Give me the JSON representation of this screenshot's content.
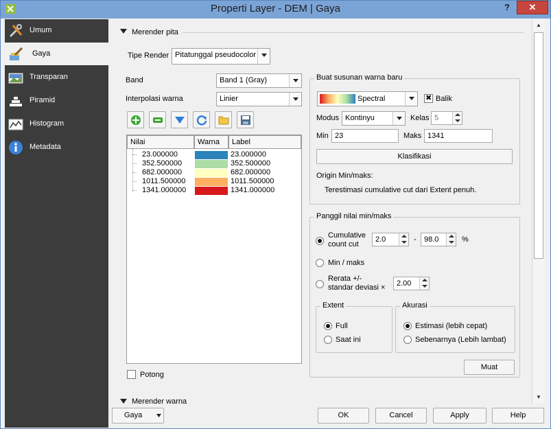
{
  "window": {
    "title": "Properti Layer - DEM | Gaya",
    "help": "?",
    "close": "✕"
  },
  "sidebar": [
    {
      "label": "Umum",
      "icon": "tools-icon"
    },
    {
      "label": "Gaya",
      "icon": "paintbrush-icon"
    },
    {
      "label": "Transparan",
      "icon": "transparency-icon"
    },
    {
      "label": "Piramid",
      "icon": "pyramid-icon"
    },
    {
      "label": "Histogram",
      "icon": "histogram-icon"
    },
    {
      "label": "Metadata",
      "icon": "info-icon"
    }
  ],
  "band_render": {
    "section": "Merender pita",
    "tipe_render_label": "Tipe Render",
    "tipe_render_value": "Pitatunggal pseudocolor",
    "band_label": "Band",
    "band_value": "Band 1 (Gray)",
    "interp_label": "Interpolasi warna",
    "interp_value": "Linier",
    "table_headers": {
      "value": "Nilai",
      "color": "Warna",
      "label": "Label"
    },
    "rows": [
      {
        "value": "23.000000",
        "color": "#2b83ba",
        "label": "23.000000"
      },
      {
        "value": "352.500000",
        "color": "#abdda4",
        "label": "352.500000"
      },
      {
        "value": "682.000000",
        "color": "#ffffbf",
        "label": "682.000000"
      },
      {
        "value": "1011.500000",
        "color": "#fdae61",
        "label": "1011.500000"
      },
      {
        "value": "1341.000000",
        "color": "#d7191c",
        "label": "1341.000000"
      }
    ],
    "potong_label": "Potong"
  },
  "new_color": {
    "title": "Buat susunan warna baru",
    "ramp": "Spectral",
    "balik_label": "Balik",
    "modus_label": "Modus",
    "modus_value": "Kontinyu",
    "kelas_label": "Kelas",
    "kelas_value": "5",
    "min_label": "Min",
    "min_value": "23",
    "maks_label": "Maks",
    "maks_value": "1341",
    "klasifikasi": "Klasifikasi",
    "origin": "Origin Min/maks:",
    "origin_desc": "Terestimasi cumulative cut dari Extent penuh."
  },
  "load_minmax": {
    "title": "Panggil nilai min/maks",
    "cumulative_label_1": "Cumulative",
    "cumulative_label_2": "count cut",
    "cut_min": "2.0",
    "dash": "-",
    "cut_max": "98.0",
    "percent": "%",
    "minmax_label": "Min / maks",
    "rerata_label_1": "Rerata +/-",
    "rerata_label_2": "standar deviasi ×",
    "std_value": "2.00",
    "extent_title": "Extent",
    "extent_full": "Full",
    "extent_current": "Saat ini",
    "akurasi_title": "Akurasi",
    "akurasi_est": "Estimasi (lebih cepat)",
    "akurasi_actual": "Sebenarnya (Lebih lambat)",
    "muat": "Muat"
  },
  "color_render_section": "Merender warna",
  "footer": {
    "style": "Gaya",
    "ok": "OK",
    "cancel": "Cancel",
    "apply": "Apply",
    "help": "Help"
  }
}
